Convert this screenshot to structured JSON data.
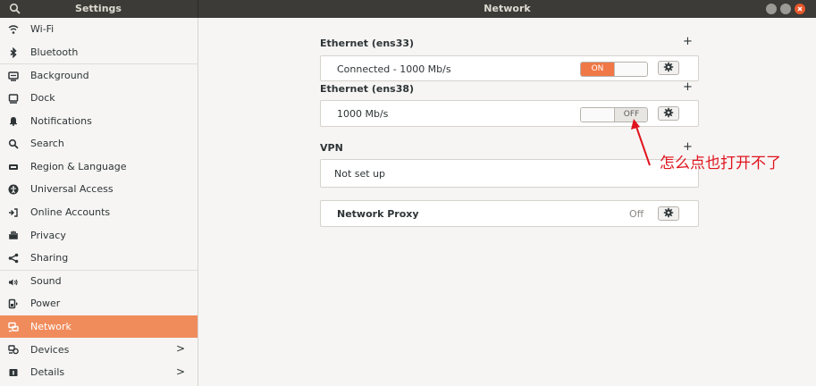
{
  "titlebar": {
    "left_title": "Settings",
    "title": "Network"
  },
  "sidebar": {
    "items": [
      {
        "label": "Wi-Fi",
        "icon": "wifi-icon"
      },
      {
        "label": "Bluetooth",
        "icon": "bluetooth-icon"
      },
      {
        "label": "Background",
        "icon": "background-icon"
      },
      {
        "label": "Dock",
        "icon": "dock-icon"
      },
      {
        "label": "Notifications",
        "icon": "bell-icon"
      },
      {
        "label": "Search",
        "icon": "search-icon"
      },
      {
        "label": "Region & Language",
        "icon": "region-icon"
      },
      {
        "label": "Universal Access",
        "icon": "accessibility-icon"
      },
      {
        "label": "Online Accounts",
        "icon": "online-accounts-icon"
      },
      {
        "label": "Privacy",
        "icon": "privacy-hand-icon"
      },
      {
        "label": "Sharing",
        "icon": "share-icon"
      },
      {
        "label": "Sound",
        "icon": "speaker-icon"
      },
      {
        "label": "Power",
        "icon": "power-icon"
      },
      {
        "label": "Network",
        "icon": "network-icon",
        "active": true
      },
      {
        "label": "Devices",
        "icon": "devices-icon",
        "chevron": ">"
      },
      {
        "label": "Details",
        "icon": "info-icon",
        "chevron": ">"
      }
    ]
  },
  "network": {
    "ethernet1": {
      "title": "Ethernet (ens33)",
      "status": "Connected - 1000 Mb/s",
      "toggle": "ON"
    },
    "ethernet2": {
      "title": "Ethernet (ens38)",
      "status": "1000 Mb/s",
      "toggle": "OFF"
    },
    "vpn": {
      "title": "VPN",
      "status": "Not set up"
    },
    "proxy": {
      "label": "Network Proxy",
      "value": "Off"
    },
    "add_symbol": "+"
  },
  "annotation": {
    "text": "怎么点也打开不了",
    "color": "#e0141e"
  },
  "colors": {
    "accent": "#f08c5c",
    "titlebar": "#3c3b37",
    "toggle_on": "#f07746"
  }
}
